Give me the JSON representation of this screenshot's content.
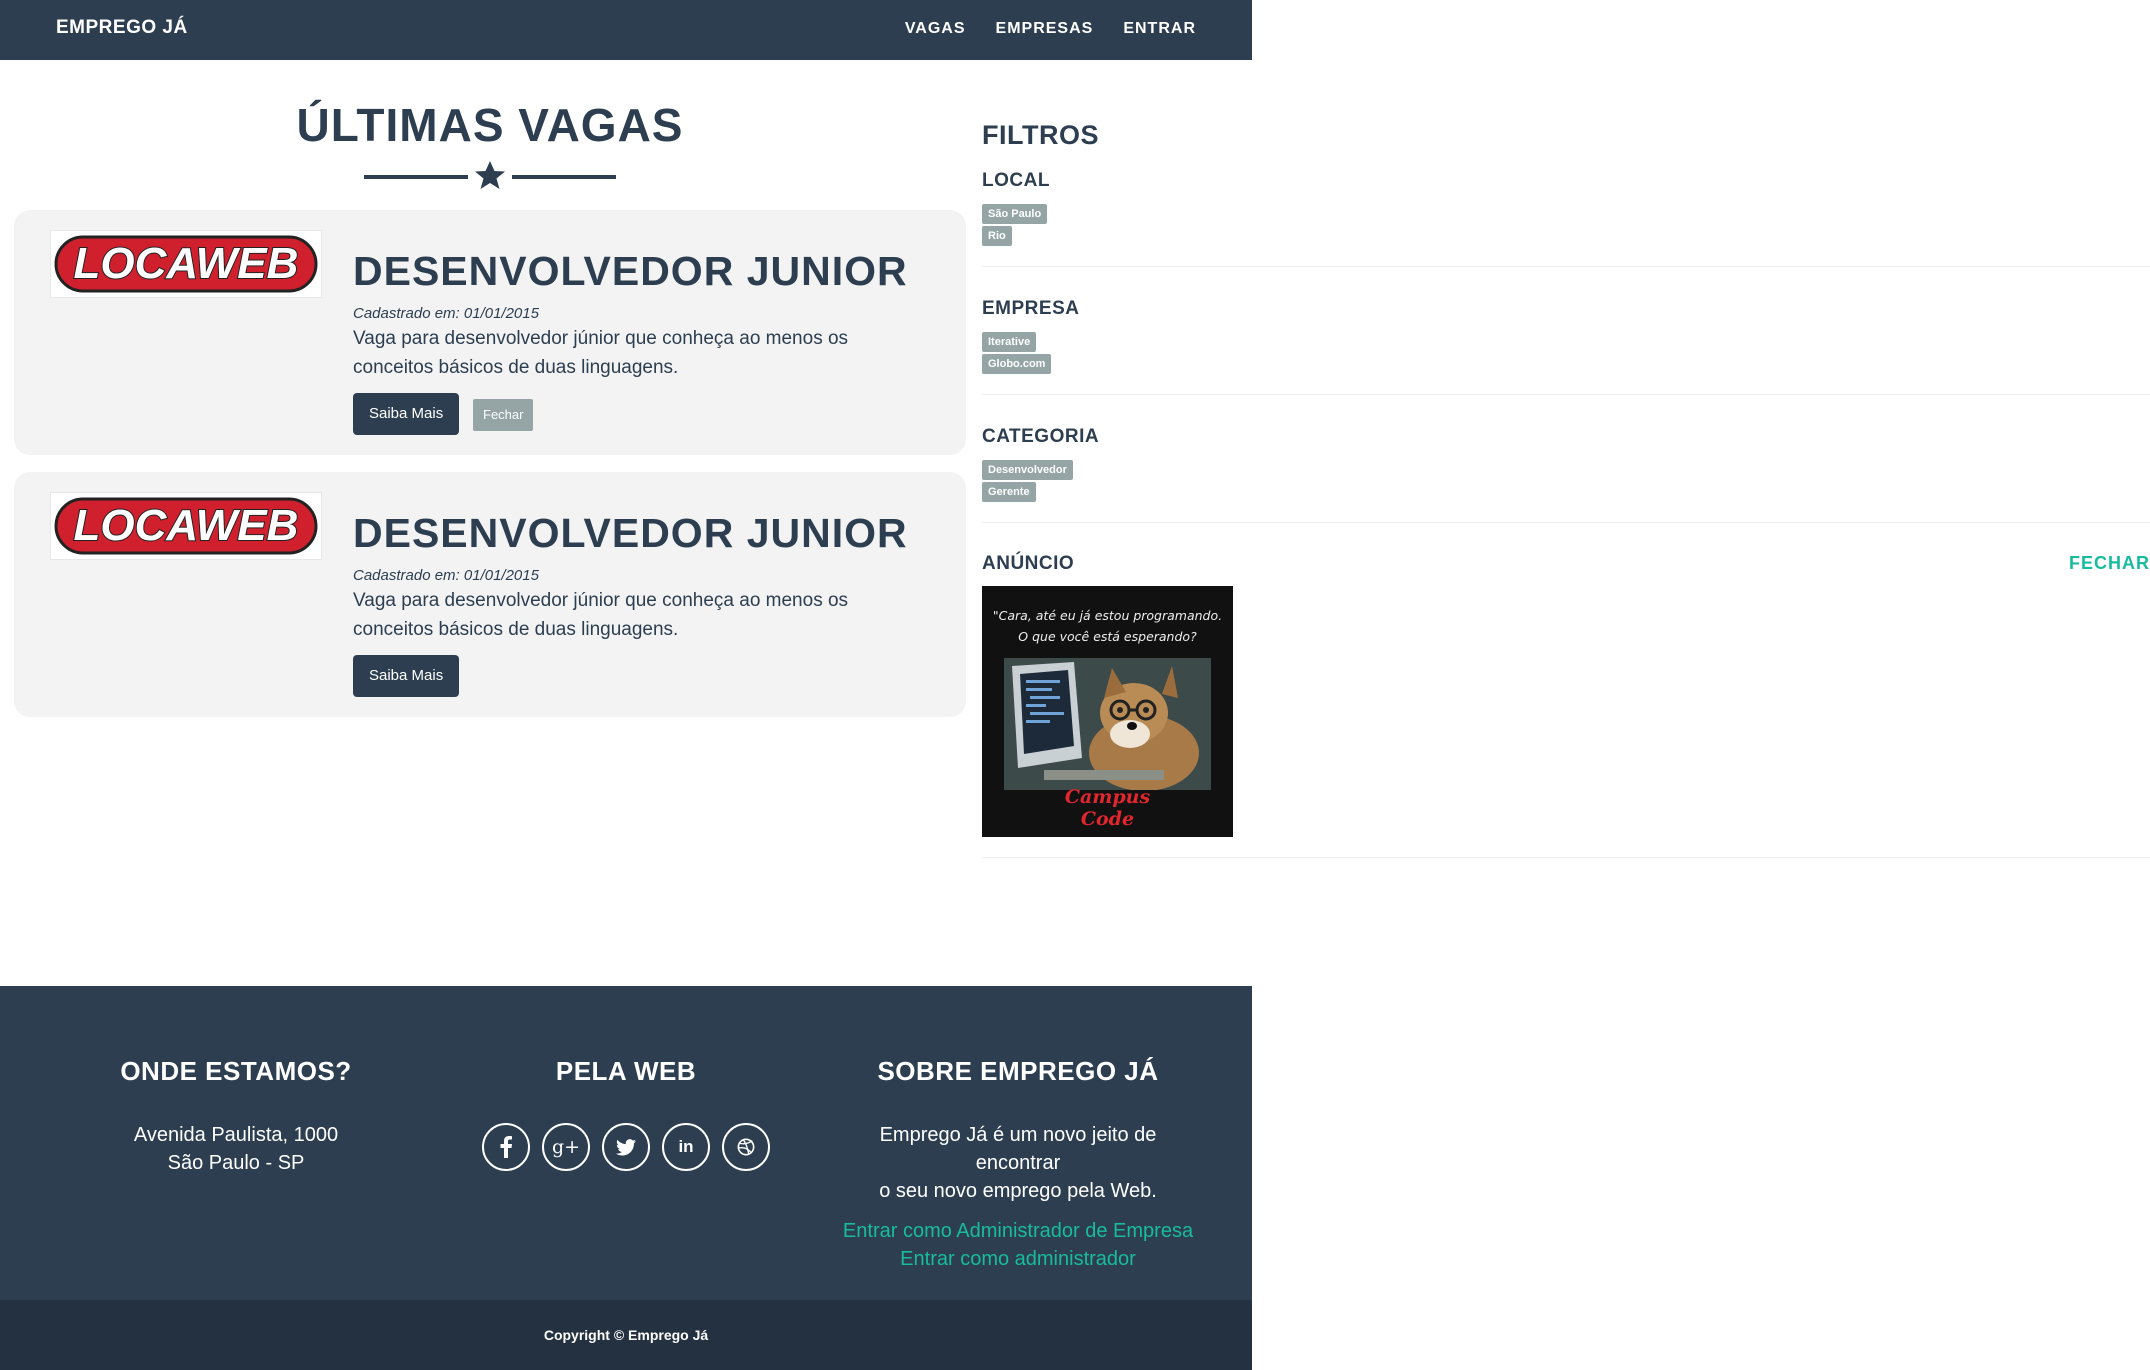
{
  "navbar": {
    "brand": "EMPREGO JÁ",
    "links": [
      "VAGAS",
      "EMPRESAS",
      "ENTRAR"
    ]
  },
  "main": {
    "title": "ÚLTIMAS VAGAS",
    "jobs": [
      {
        "logo_text": "LOCAWEB",
        "title": "DESENVOLVEDOR JUNIOR",
        "date": "Cadastrado em: 01/01/2015",
        "description": "Vaga para desenvolvedor júnior que conheça ao menos os conceitos básicos de duas linguagens.",
        "more_label": "Saiba Mais",
        "close_label": "Fechar"
      },
      {
        "logo_text": "LOCAWEB",
        "title": "DESENVOLVEDOR JUNIOR",
        "date": "Cadastrado em: 01/01/2015",
        "description": "Vaga para desenvolvedor júnior que conheça ao menos os conceitos básicos de duas linguagens.",
        "more_label": "Saiba Mais"
      }
    ]
  },
  "filters": {
    "title": "FILTROS",
    "groups": [
      {
        "label": "LOCAL",
        "tags": [
          "São Paulo",
          "Rio"
        ]
      },
      {
        "label": "EMPRESA",
        "tags": [
          "Iterative",
          "Globo.com"
        ]
      },
      {
        "label": "CATEGORIA",
        "tags": [
          "Desenvolvedor",
          "Gerente"
        ]
      }
    ],
    "ad": {
      "label": "ANÚNCIO",
      "close_label": "FECHAR",
      "quote_line1": "\"Cara, até eu já estou programando.",
      "quote_line2": "O que você está esperando?",
      "brand_line1": "Campus",
      "brand_line2": "Code"
    }
  },
  "footer": {
    "location": {
      "title": "ONDE ESTAMOS?",
      "line1": "Avenida Paulista, 1000",
      "line2": "São Paulo - SP"
    },
    "web": {
      "title": "PELA WEB",
      "icons": [
        "facebook-icon",
        "google-plus-icon",
        "twitter-icon",
        "linkedin-icon",
        "dribbble-icon"
      ]
    },
    "about": {
      "title": "SOBRE EMPREGO JÁ",
      "line1": "Emprego Já é um novo jeito de encontrar",
      "line2": "o seu novo emprego pela Web.",
      "link1": "Entrar como Administrador de Empresa",
      "link2": "Entrar como administrador"
    },
    "copyright": "Copyright © Emprego Já"
  },
  "colors": {
    "primary": "#2c3e50",
    "accent": "#18bc9c",
    "tag": "#95a5a6",
    "card": "#f3f3f3",
    "logo_red": "#d0202e"
  }
}
